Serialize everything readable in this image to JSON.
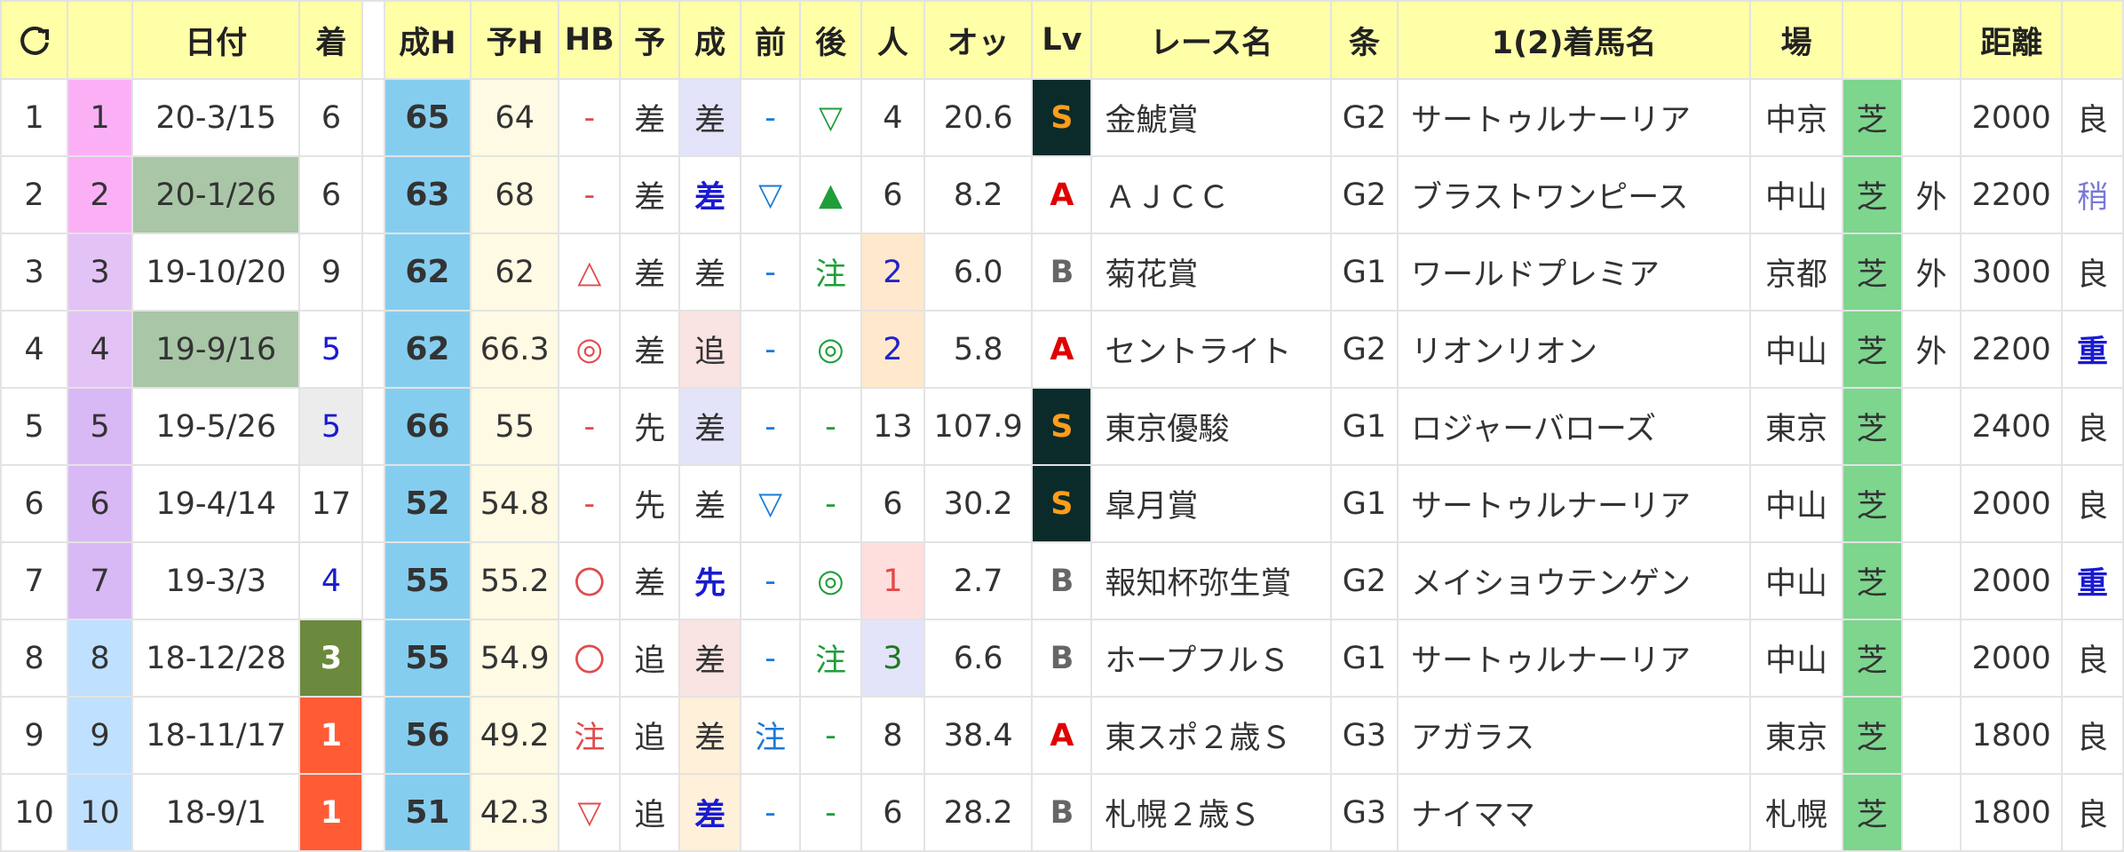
{
  "headers": {
    "refresh_icon": "refresh-icon",
    "frame": "",
    "date": "日付",
    "rank": "着",
    "gap": "",
    "seiseki_h": "成H",
    "yoso_h": "予H",
    "hb": "HB",
    "yoso": "予",
    "sei": "成",
    "mae": "前",
    "ato": "後",
    "pop": "人",
    "odds": "オッ",
    "lv": "Lv",
    "race": "レース名",
    "cond": "条",
    "winner": "1(2)着馬名",
    "venue": "場",
    "track": "",
    "inout": "",
    "dist": "距離",
    "baba": ""
  },
  "rows": [
    {
      "no": "1",
      "frame": "1",
      "date": "20-3/15",
      "rank": "6",
      "fh": "65",
      "yh": "64",
      "hb": "-",
      "yoso": "差",
      "sei": "差",
      "mae": "-",
      "ato": "▽",
      "pop": "4",
      "odds": "20.6",
      "lv": "S",
      "race": "金鯱賞",
      "cond": "G2",
      "winner": "サートゥルナーリア",
      "venue": "中京",
      "track": "芝",
      "inout": "",
      "dist": "2000",
      "baba": "良"
    },
    {
      "no": "2",
      "frame": "2",
      "date": "20-1/26",
      "rank": "6",
      "fh": "63",
      "yh": "68",
      "hb": "-",
      "yoso": "差",
      "sei": "差",
      "mae": "▽",
      "ato": "▲",
      "pop": "6",
      "odds": "8.2",
      "lv": "A",
      "race": "ＡＪＣＣ",
      "cond": "G2",
      "winner": "ブラストワンピース",
      "venue": "中山",
      "track": "芝",
      "inout": "外",
      "dist": "2200",
      "baba": "稍"
    },
    {
      "no": "3",
      "frame": "3",
      "date": "19-10/20",
      "rank": "9",
      "fh": "62",
      "yh": "62",
      "hb": "△",
      "yoso": "差",
      "sei": "差",
      "mae": "-",
      "ato": "注",
      "pop": "2",
      "odds": "6.0",
      "lv": "B",
      "race": "菊花賞",
      "cond": "G1",
      "winner": "ワールドプレミア",
      "venue": "京都",
      "track": "芝",
      "inout": "外",
      "dist": "3000",
      "baba": "良"
    },
    {
      "no": "4",
      "frame": "4",
      "date": "19-9/16",
      "rank": "5",
      "fh": "62",
      "yh": "66.3",
      "hb": "◎",
      "yoso": "差",
      "sei": "追",
      "mae": "-",
      "ato": "◎",
      "pop": "2",
      "odds": "5.8",
      "lv": "A",
      "race": "セントライト",
      "cond": "G2",
      "winner": "リオンリオン",
      "venue": "中山",
      "track": "芝",
      "inout": "外",
      "dist": "2200",
      "baba": "重"
    },
    {
      "no": "5",
      "frame": "5",
      "date": "19-5/26",
      "rank": "5",
      "fh": "66",
      "yh": "55",
      "hb": "-",
      "yoso": "先",
      "sei": "差",
      "mae": "-",
      "ato": "-",
      "pop": "13",
      "odds": "107.9",
      "lv": "S",
      "race": "東京優駿",
      "cond": "G1",
      "winner": "ロジャーバローズ",
      "venue": "東京",
      "track": "芝",
      "inout": "",
      "dist": "2400",
      "baba": "良"
    },
    {
      "no": "6",
      "frame": "6",
      "date": "19-4/14",
      "rank": "17",
      "fh": "52",
      "yh": "54.8",
      "hb": "-",
      "yoso": "先",
      "sei": "差",
      "mae": "▽",
      "ato": "-",
      "pop": "6",
      "odds": "30.2",
      "lv": "S",
      "race": "皐月賞",
      "cond": "G1",
      "winner": "サートゥルナーリア",
      "venue": "中山",
      "track": "芝",
      "inout": "",
      "dist": "2000",
      "baba": "良"
    },
    {
      "no": "7",
      "frame": "7",
      "date": "19-3/3",
      "rank": "4",
      "fh": "55",
      "yh": "55.2",
      "hb": "〇",
      "yoso": "差",
      "sei": "先",
      "mae": "-",
      "ato": "◎",
      "pop": "1",
      "odds": "2.7",
      "lv": "B",
      "race": "報知杯弥生賞",
      "cond": "G2",
      "winner": "メイショウテンゲン",
      "venue": "中山",
      "track": "芝",
      "inout": "",
      "dist": "2000",
      "baba": "重"
    },
    {
      "no": "8",
      "frame": "8",
      "date": "18-12/28",
      "rank": "3",
      "fh": "55",
      "yh": "54.9",
      "hb": "〇",
      "yoso": "追",
      "sei": "差",
      "mae": "-",
      "ato": "注",
      "pop": "3",
      "odds": "6.6",
      "lv": "B",
      "race": "ホープフルＳ",
      "cond": "G1",
      "winner": "サートゥルナーリア",
      "venue": "中山",
      "track": "芝",
      "inout": "",
      "dist": "2000",
      "baba": "良"
    },
    {
      "no": "9",
      "frame": "9",
      "date": "18-11/17",
      "rank": "1",
      "fh": "56",
      "yh": "49.2",
      "hb": "注",
      "yoso": "追",
      "sei": "差",
      "mae": "注",
      "ato": "-",
      "pop": "8",
      "odds": "38.4",
      "lv": "A",
      "race": "東スポ２歳Ｓ",
      "cond": "G3",
      "winner": "アガラス",
      "venue": "東京",
      "track": "芝",
      "inout": "",
      "dist": "1800",
      "baba": "良"
    },
    {
      "no": "10",
      "frame": "10",
      "date": "18-9/1",
      "rank": "1",
      "fh": "51",
      "yh": "42.3",
      "hb": "▽",
      "yoso": "追",
      "sei": "差",
      "mae": "-",
      "ato": "-",
      "pop": "6",
      "odds": "28.2",
      "lv": "B",
      "race": "札幌２歳Ｓ",
      "cond": "G3",
      "winner": "ナイママ",
      "venue": "札幌",
      "track": "芝",
      "inout": "",
      "dist": "1800",
      "baba": "良"
    }
  ],
  "styles": {
    "frame_colors": [
      "#fbb0f6",
      "#fbb0f6",
      "#e3c2f6",
      "#e3c2f6",
      "#d9b8f6",
      "#d9b8f6",
      "#d9b8f6",
      "#bfe0ff",
      "#bfe0ff",
      "#bfe0ff"
    ],
    "date_highlight_rows": [
      1,
      3
    ],
    "rank_classes": [
      "",
      "",
      "",
      "rank-blue",
      "rank-blue-bg",
      "",
      "rank-blue",
      "rank-green",
      "rank-red",
      "rank-red"
    ],
    "sei_classes": [
      "sei-blue",
      "sei-bold",
      "",
      "sei-red",
      "sei-blue",
      "",
      "sei-bold",
      "sei-red",
      "sei-orange",
      "sei-orange sei-bold"
    ],
    "pop_classes": [
      "",
      "",
      "pop-orange",
      "pop-orange",
      "",
      "",
      "pop-red",
      "pop-blue",
      "",
      ""
    ],
    "baba_classes": [
      "",
      "baba-soft",
      "",
      "baba-heavy",
      "",
      "",
      "baba-heavy",
      "",
      "",
      ""
    ]
  }
}
